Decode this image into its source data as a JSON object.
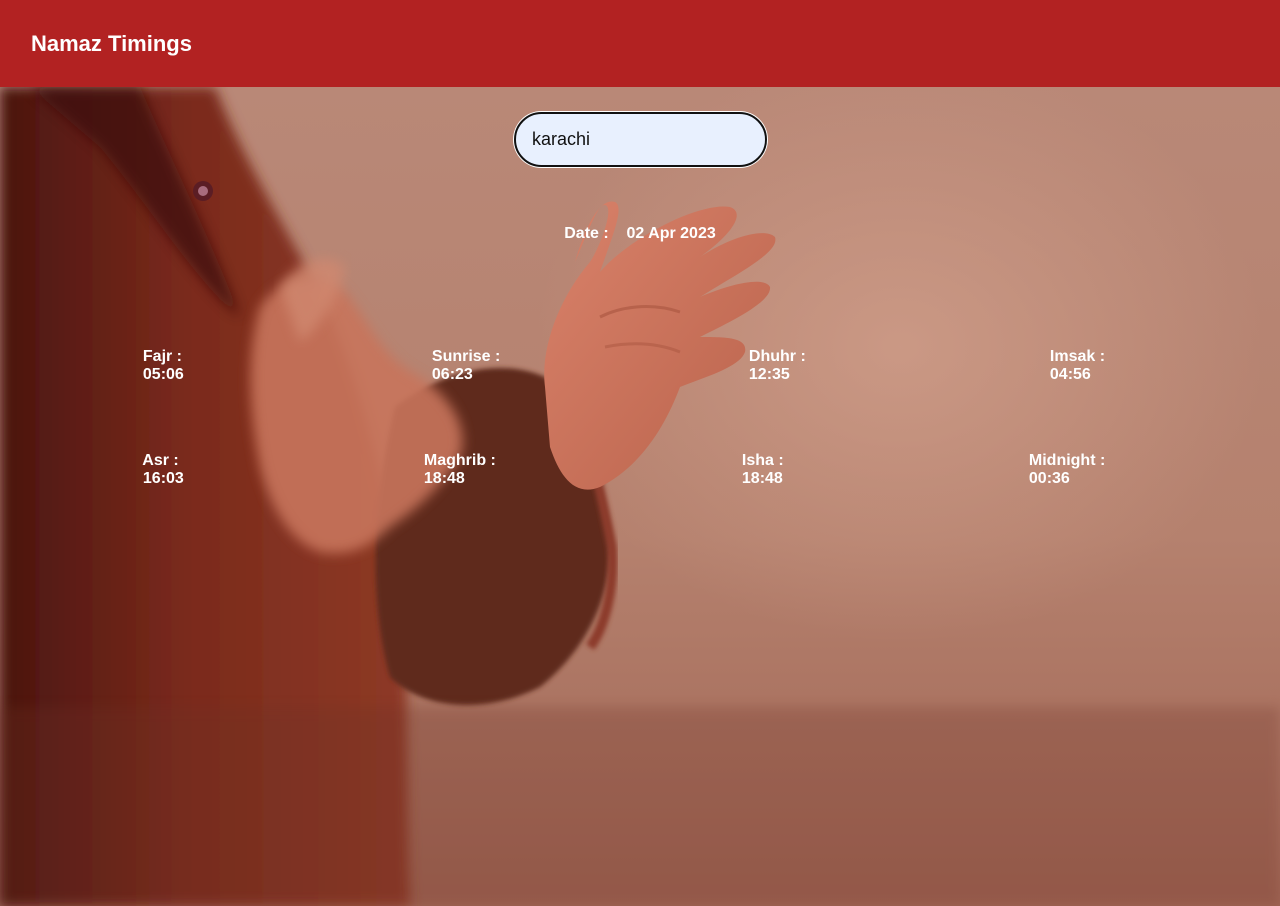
{
  "header": {
    "title": "Namaz Timings"
  },
  "search": {
    "value": "karachi",
    "placeholder": ""
  },
  "date": {
    "label": "Date :",
    "value": "02 Apr 2023"
  },
  "timings": [
    {
      "label": "Fajr :",
      "value": "05:06"
    },
    {
      "label": "Sunrise :",
      "value": "06:23"
    },
    {
      "label": "Dhuhr :",
      "value": "12:35"
    },
    {
      "label": "Imsak :",
      "value": "04:56"
    },
    {
      "label": "Asr :",
      "value": "16:03"
    },
    {
      "label": "Maghrib :",
      "value": "18:48"
    },
    {
      "label": "Isha :",
      "value": "18:48"
    },
    {
      "label": "Midnight :",
      "value": "00:36"
    }
  ],
  "colors": {
    "header": "#b22222",
    "text": "#ffffff",
    "input_bg": "#e8f0fe"
  }
}
